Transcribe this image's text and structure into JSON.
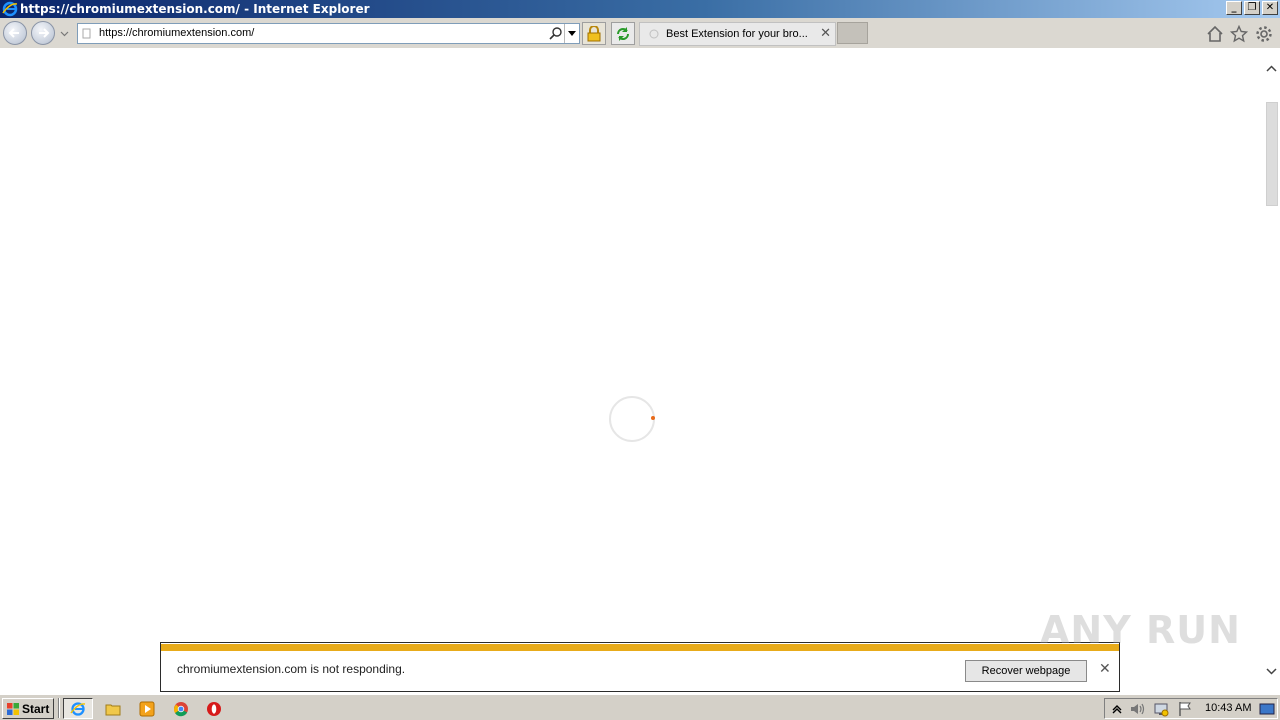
{
  "window": {
    "title": "https://chromiumextension.com/ - Internet Explorer",
    "controls": [
      "minimize",
      "restore",
      "close"
    ]
  },
  "navbar": {
    "back_icon": "back-arrow-icon",
    "forward_icon": "forward-arrow-icon",
    "address": {
      "value": "https://chromiumextension.com/",
      "placeholder": ""
    },
    "tab": {
      "title": "Best Extension for your bro..."
    },
    "tools": [
      "home-icon",
      "favorites-star-icon",
      "settings-gear-icon"
    ]
  },
  "page": {
    "loading_spinner": "loading-spinner",
    "accent": "#e86a1a"
  },
  "notification": {
    "message": "chromiumextension.com is not responding.",
    "action_label": "Recover webpage",
    "stripe_color": "#e8ab1a"
  },
  "watermark": {
    "text": "ANY RUN"
  },
  "taskbar": {
    "start_label": "Start",
    "items": [
      "internet-explorer-icon",
      "file-explorer-icon",
      "media-player-icon",
      "chrome-icon",
      "opera-icon"
    ],
    "clock": "10:43 AM"
  }
}
